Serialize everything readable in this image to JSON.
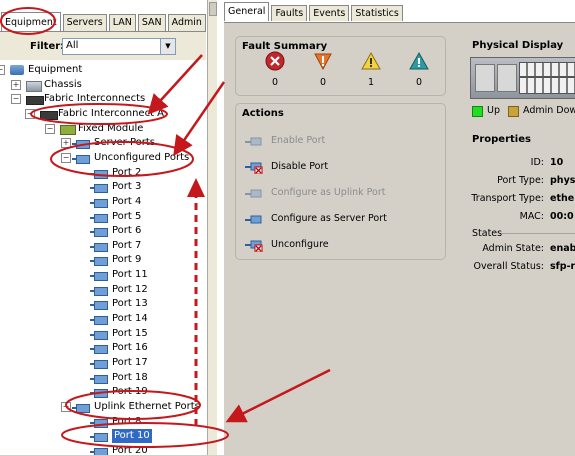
{
  "left_tabs": [
    "Equipment",
    "Servers",
    "LAN",
    "SAN",
    "Admin"
  ],
  "filter": {
    "label": "Filter:",
    "value": "All"
  },
  "tree": [
    {
      "label": "Equipment",
      "icon": "equipment-icon",
      "toggle": "−"
    },
    {
      "label": "Chassis",
      "icon": "chassis-icon",
      "toggle": "+"
    },
    {
      "label": "Fabric Interconnects",
      "icon": "fabric-interconnect-icon",
      "toggle": "−"
    },
    {
      "label": "Fabric Interconnect A",
      "icon": "fabric-interconnect-icon",
      "toggle": "−"
    },
    {
      "label": "Fixed Module",
      "icon": "fixed-module-icon",
      "toggle": "−"
    },
    {
      "label": "Server Ports",
      "icon": "port-icon",
      "toggle": "+"
    },
    {
      "label": "Unconfigured Ports",
      "icon": "port-icon",
      "toggle": "−"
    },
    {
      "label": "Port 2",
      "icon": "port-icon"
    },
    {
      "label": "Port 3",
      "icon": "port-icon"
    },
    {
      "label": "Port 4",
      "icon": "port-icon"
    },
    {
      "label": "Port 5",
      "icon": "port-icon"
    },
    {
      "label": "Port 6",
      "icon": "port-icon"
    },
    {
      "label": "Port 7",
      "icon": "port-icon"
    },
    {
      "label": "Port 9",
      "icon": "port-icon"
    },
    {
      "label": "Port 11",
      "icon": "port-icon"
    },
    {
      "label": "Port 12",
      "icon": "port-icon"
    },
    {
      "label": "Port 13",
      "icon": "port-icon"
    },
    {
      "label": "Port 14",
      "icon": "port-icon"
    },
    {
      "label": "Port 15",
      "icon": "port-icon"
    },
    {
      "label": "Port 16",
      "icon": "port-icon"
    },
    {
      "label": "Port 17",
      "icon": "port-icon"
    },
    {
      "label": "Port 18",
      "icon": "port-icon"
    },
    {
      "label": "Port 19",
      "icon": "port-icon"
    },
    {
      "label": "Uplink Ethernet Ports",
      "icon": "port-icon",
      "toggle": "−"
    },
    {
      "label": "Port 8",
      "icon": "port-icon"
    },
    {
      "label": "Port 10",
      "icon": "port-icon",
      "selected": true
    },
    {
      "label": "Port 20",
      "icon": "port-icon"
    }
  ],
  "right_tabs": [
    "General",
    "Faults",
    "Events",
    "Statistics"
  ],
  "fault_summary": {
    "title": "Fault Summary",
    "items": [
      {
        "name": "critical",
        "icon": "critical-fault-icon",
        "count": "0",
        "color": "#c0282d"
      },
      {
        "name": "major",
        "icon": "major-fault-icon",
        "count": "0",
        "color": "#e8742a"
      },
      {
        "name": "minor",
        "icon": "minor-fault-icon",
        "count": "1",
        "color": "#f3d23a"
      },
      {
        "name": "warning",
        "icon": "warning-fault-icon",
        "count": "0",
        "color": "#2e9aa3"
      }
    ]
  },
  "actions": {
    "title": "Actions",
    "items": [
      {
        "label": "Enable Port",
        "enabled": false
      },
      {
        "label": "Disable Port",
        "enabled": true
      },
      {
        "label": "Configure as Uplink Port",
        "enabled": false
      },
      {
        "label": "Configure as Server Port",
        "enabled": true
      },
      {
        "label": "Unconfigure",
        "enabled": true
      }
    ]
  },
  "physical_display": {
    "title": "Physical Display",
    "legend": [
      {
        "label": "Up",
        "color": "#22dd22"
      },
      {
        "label": "Admin Down",
        "color": "#c9a33a"
      }
    ]
  },
  "properties": {
    "title": "Properties",
    "rows": [
      {
        "key": "ID:",
        "value": "10"
      },
      {
        "key": "Port Type:",
        "value": "phys"
      },
      {
        "key": "Transport Type:",
        "value": "ethe"
      },
      {
        "key": "MAC:",
        "value": "00:0"
      }
    ],
    "states_title": "States",
    "states": [
      {
        "key": "Admin State:",
        "value": "enab"
      },
      {
        "key": "Overall Status:",
        "value": "sfp-r"
      }
    ]
  }
}
